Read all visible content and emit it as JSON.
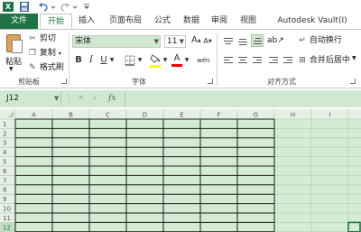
{
  "quick_access": {
    "app_icon": "X",
    "icons": [
      "excel-logo-icon",
      "save-icon",
      "undo-icon",
      "redo-icon",
      "customize-qat-icon"
    ]
  },
  "tabs": [
    {
      "key": "file",
      "label": "文件"
    },
    {
      "key": "home",
      "label": "开始"
    },
    {
      "key": "insert",
      "label": "插入"
    },
    {
      "key": "layout",
      "label": "页面布局"
    },
    {
      "key": "formula",
      "label": "公式"
    },
    {
      "key": "data",
      "label": "数据"
    },
    {
      "key": "review",
      "label": "审阅"
    },
    {
      "key": "view",
      "label": "视图"
    },
    {
      "key": "vault",
      "label": "Autodesk Vault(Ⅰ)"
    }
  ],
  "active_tab": "home",
  "ribbon": {
    "clipboard": {
      "group_label": "剪贴板",
      "paste": "粘贴",
      "cut": "剪切",
      "copy": "复制",
      "format_painter": "格式刷"
    },
    "font": {
      "group_label": "字体",
      "font_name": "宋体",
      "font_size": "11",
      "grow": "A",
      "shrink": "A",
      "bold": "B",
      "italic": "I",
      "underline": "U",
      "font_color_glyph": "A",
      "phonetic": "wén",
      "fill_color": "#ffff00",
      "font_color": "#ff0000"
    },
    "alignment": {
      "group_label": "对齐方式",
      "wrap_text": "自动换行",
      "merge_center": "合并后居中"
    }
  },
  "formula_bar": {
    "name_box": "J12",
    "formula": "",
    "fx": "fx"
  },
  "sheet": {
    "columns": [
      "A",
      "B",
      "C",
      "D",
      "E",
      "F",
      "G",
      "H",
      "I"
    ],
    "rows": [
      "1",
      "2",
      "3",
      "4",
      "5",
      "6",
      "7",
      "8",
      "9",
      "10",
      "11",
      "12"
    ],
    "active_cell": "J12",
    "cell_fill": "#d3ecd3",
    "grid_color": "#b5d4b5",
    "border_color": "#1a1a1a"
  },
  "colors": {
    "accent": "#217346",
    "background_green": "#cfe8cf"
  }
}
